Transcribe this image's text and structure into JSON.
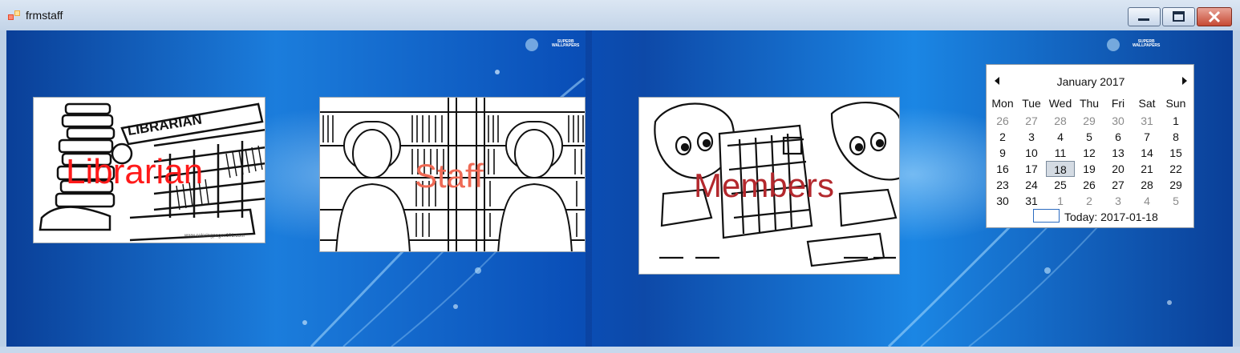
{
  "window": {
    "title": "frmstaff",
    "icon": "windows-forms-app-icon",
    "controls": [
      "minimize-icon",
      "maximize-icon",
      "close-icon"
    ]
  },
  "background": {
    "logo_text": "SUPERB\nWALLPAPERS"
  },
  "cards": [
    {
      "label": "Librarian",
      "label_color": "#ff1a1a",
      "sign_text": "LIBRARIAN",
      "watermark": "www.coloringpages101.com"
    },
    {
      "label": "Staff",
      "label_color": "#ef6a55"
    },
    {
      "label": "Members",
      "label_color": "#b3282d"
    }
  ],
  "calendar": {
    "month_title": "January 2017",
    "weekdays": [
      "Mon",
      "Tue",
      "Wed",
      "Thu",
      "Fri",
      "Sat",
      "Sun"
    ],
    "weeks": [
      [
        [
          "26",
          true
        ],
        [
          "27",
          true
        ],
        [
          "28",
          true
        ],
        [
          "29",
          true
        ],
        [
          "30",
          true
        ],
        [
          "31",
          true
        ],
        [
          "1",
          false
        ]
      ],
      [
        [
          "2",
          false
        ],
        [
          "3",
          false
        ],
        [
          "4",
          false
        ],
        [
          "5",
          false
        ],
        [
          "6",
          false
        ],
        [
          "7",
          false
        ],
        [
          "8",
          false
        ]
      ],
      [
        [
          "9",
          false
        ],
        [
          "10",
          false
        ],
        [
          "11",
          false
        ],
        [
          "12",
          false
        ],
        [
          "13",
          false
        ],
        [
          "14",
          false
        ],
        [
          "15",
          false
        ]
      ],
      [
        [
          "16",
          false
        ],
        [
          "17",
          false
        ],
        [
          "18",
          false
        ],
        [
          "19",
          false
        ],
        [
          "20",
          false
        ],
        [
          "21",
          false
        ],
        [
          "22",
          false
        ]
      ],
      [
        [
          "23",
          false
        ],
        [
          "24",
          false
        ],
        [
          "25",
          false
        ],
        [
          "26",
          false
        ],
        [
          "27",
          false
        ],
        [
          "28",
          false
        ],
        [
          "29",
          false
        ]
      ],
      [
        [
          "30",
          false
        ],
        [
          "31",
          false
        ],
        [
          "1",
          true
        ],
        [
          "2",
          true
        ],
        [
          "3",
          true
        ],
        [
          "4",
          true
        ],
        [
          "5",
          true
        ]
      ]
    ],
    "selected_day": "18",
    "today_label": "Today: 2017-01-18"
  }
}
